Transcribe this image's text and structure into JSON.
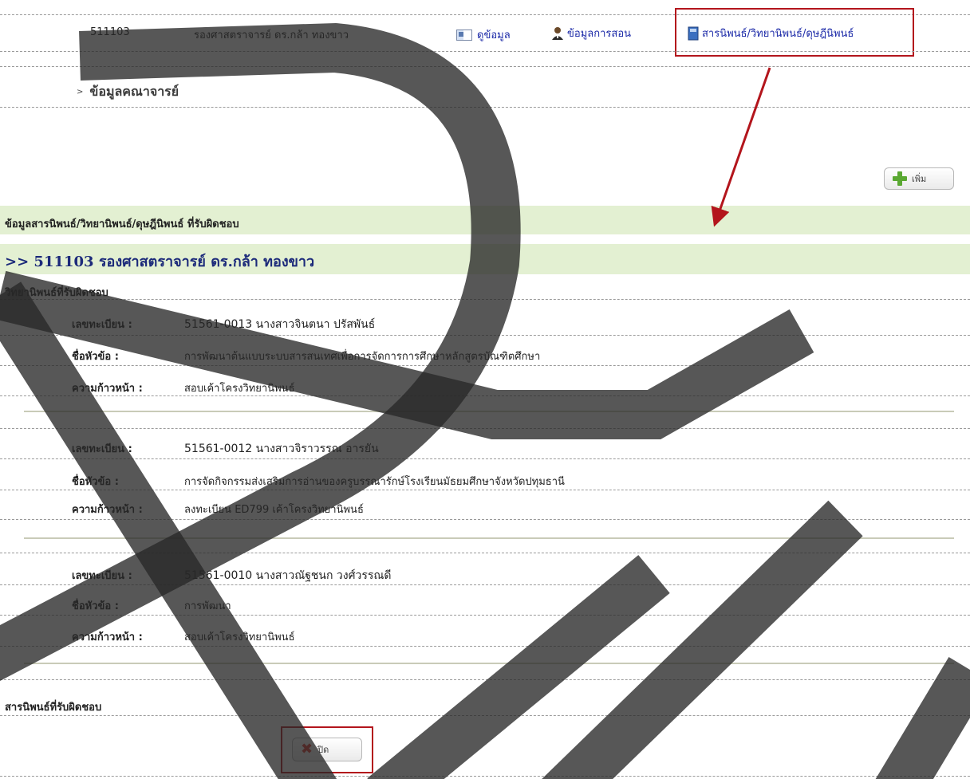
{
  "toprow": {
    "code": "511103",
    "name": "รองศาสตราจารย์ ดร.กล้า ทองขาว",
    "view_link": "ดูข้อมูล",
    "teaching_link": "ข้อมูลการสอน",
    "thesis_link": "สารนิพนธ์/วิทยานิพนธ์/ดุษฎีนิพนธ์"
  },
  "section_title": "ข้อมูลคณาจารย์",
  "add_button": "เพิ่ม",
  "green_header": "ข้อมูลสารนิพนธ์/วิทยานิพนธ์/ดุษฎีนิพนธ์ ที่รับผิดชอบ",
  "professor_heading": ">> 511103  รองศาสตราจารย์ ดร.กล้า ทองขาว",
  "thesis_section": "วิทยานิพนธ์ที่รับผิดชอบ",
  "labels": {
    "reg": "เลขทะเบียน :",
    "topic": "ชื่อหัวข้อ :",
    "progress": "ความก้าวหน้า :"
  },
  "records": [
    {
      "reg": "51561-0013 นางสาวจินตนา ปรัสพันธ์",
      "topic": "การพัฒนาต้นแบบระบบสารสนเทศเพื่อการจัดการการศึกษาหลักสูตรบัณฑิตศึกษา",
      "progress": "สอบเค้าโครงวิทยานิพนธ์"
    },
    {
      "reg": "51561-0012 นางสาวจิราวรรณ อารยัน",
      "topic": "การจัดกิจกรรมส่งเสริมการอ่านของครูบรรณารักษ์โรงเรียนมัธยมศึกษาจังหวัดปทุมธานี",
      "progress": "ลงทะเบียน ED799 เค้าโครงวิทยานิพนธ์"
    },
    {
      "reg": "51561-0010 นางสาวณัฐชนก วงศ์วรรณดี",
      "topic": "การพัฒนา",
      "progress": "สอบเค้าโครงวิทยานิพนธ์"
    }
  ],
  "independent_section": "สารนิพนธ์ที่รับผิดชอบ",
  "close_button": "ปิด",
  "colors": {
    "link": "#1c2aa8",
    "green_bar": "#e3f0d2",
    "highlight_red": "#b3151c",
    "heading_navy": "#1c2a7a"
  }
}
